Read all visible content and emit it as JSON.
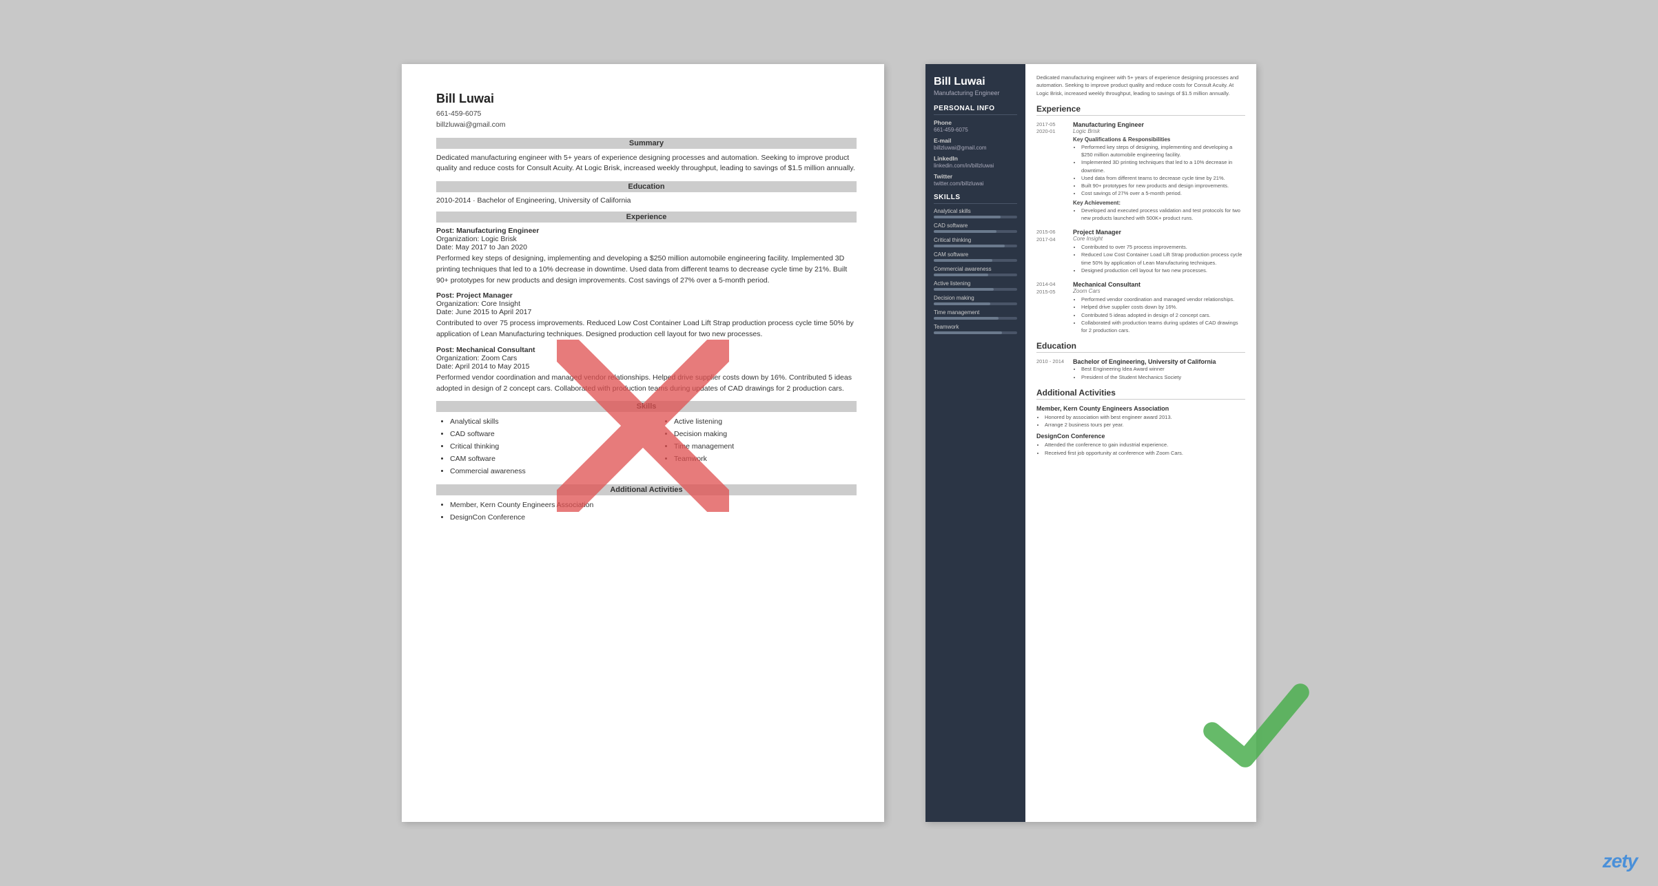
{
  "left_resume": {
    "name": "Bill Luwai",
    "phone": "661-459-6075",
    "email": "billzluwai@gmail.com",
    "summary_header": "Summary",
    "summary_text": "Dedicated manufacturing engineer with 5+ years of experience designing processes and automation. Seeking to improve product quality and reduce costs for Consult Acuity. At Logic Brisk, increased weekly throughput, leading to savings of $1.5 million annually.",
    "education_header": "Education",
    "education_entry": "2010-2014     ·  Bachelor of Engineering, University of California",
    "experience_header": "Experience",
    "exp1_post": "Post: Manufacturing Engineer",
    "exp1_org": "Organization: Logic Brisk",
    "exp1_date": "Date: May 2017 to Jan 2020",
    "exp1_body": "Performed key steps of designing, implementing and developing a $250 million automobile engineering facility. Implemented 3D printing techniques that led to a 10% decrease in downtime. Used data from different teams to decrease cycle time by 21%. Built 90+ prototypes for new products and design improvements. Cost savings of 27% over a 5-month period.",
    "exp2_post": "Post: Project Manager",
    "exp2_org": "Organization: Core Insight",
    "exp2_date": "Date: June 2015 to April 2017",
    "exp2_body": "Contributed to over 75 process improvements. Reduced Low Cost Container Load Lift Strap production process cycle time 50% by application of Lean Manufacturing techniques. Designed production cell layout for two new processes.",
    "exp3_post": "Post: Mechanical Consultant",
    "exp3_org": "Organization: Zoom Cars",
    "exp3_date": "Date: April 2014 to May 2015",
    "exp3_body": "Performed vendor coordination and managed vendor relationships. Helped drive supplier costs down by 16%. Contributed 5 ideas adopted in design of 2 concept cars. Collaborated with production teams during updates of CAD drawings for 2 production cars.",
    "skills_header": "Skills",
    "skills_col1": [
      "Analytical skills",
      "CAD software",
      "Critical thinking",
      "CAM software",
      "Commercial awareness"
    ],
    "skills_col2": [
      "Active listening",
      "Decision making",
      "Time management",
      "Teamwork"
    ],
    "additional_header": "Additional Activities",
    "additional_items": [
      "Member, Kern County Engineers Association",
      "DesignCon Conference"
    ]
  },
  "right_resume": {
    "name": "Bill Luwai",
    "title": "Manufacturing Engineer",
    "summary": "Dedicated manufacturing engineer with 5+ years of experience designing processes and automation. Seeking to improve product quality and reduce costs for Consult Acuity. At Logic Brisk, increased weekly throughput, leading to savings of $1.5 million annually.",
    "sidebar": {
      "personal_info_title": "Personal Info",
      "phone_label": "Phone",
      "phone_value": "661-459-6075",
      "email_label": "E-mail",
      "email_value": "billzluwai@gmail.com",
      "linkedin_label": "LinkedIn",
      "linkedin_value": "linkedin.com/in/billzluwai",
      "twitter_label": "Twitter",
      "twitter_value": "twitter.com/billzluwai",
      "skills_title": "Skills",
      "skills": [
        {
          "name": "Analytical skills",
          "pct": 80
        },
        {
          "name": "CAD software",
          "pct": 75
        },
        {
          "name": "Critical thinking",
          "pct": 85
        },
        {
          "name": "CAM software",
          "pct": 70
        },
        {
          "name": "Commercial awareness",
          "pct": 65
        },
        {
          "name": "Active listening",
          "pct": 72
        },
        {
          "name": "Decision making",
          "pct": 68
        },
        {
          "name": "Time management",
          "pct": 78
        },
        {
          "name": "Teamwork",
          "pct": 82
        }
      ]
    },
    "experience_title": "Experience",
    "experiences": [
      {
        "dates_start": "2017-05",
        "dates_end": "2020-01",
        "title": "Manufacturing Engineer",
        "company": "Logic Brisk",
        "qualifications_title": "Key Qualifications & Responsibilities",
        "qualifications": [
          "Performed key steps of designing, implementing and developing a $250 million automobile engineering facility.",
          "Implemented 3D printing techniques that led to a 10% decrease in downtime.",
          "Used data from different teams to decrease cycle time by 21%.",
          "Built 90+ prototypes for new products and design improvements.",
          "Cost savings of 27% over a 5-month period."
        ],
        "achievement_title": "Key Achievement:",
        "achievements": [
          "Developed and executed process validation and test protocols for two new products launched with 500K+ product runs."
        ]
      },
      {
        "dates_start": "2015-06",
        "dates_end": "2017-04",
        "title": "Project Manager",
        "company": "Core Insight",
        "qualifications": [
          "Contributed to over 75 process improvements.",
          "Reduced Low Cost Container Load Lift Strap production process cycle time 50% by application of Lean Manufacturing techniques.",
          "Designed production cell layout for two new processes."
        ]
      },
      {
        "dates_start": "2014-04",
        "dates_end": "2015-05",
        "title": "Mechanical Consultant",
        "company": "Zoom Cars",
        "qualifications": [
          "Performed vendor coordination and managed vendor relationships.",
          "Helped drive supplier costs down by 16%.",
          "Contributed 5 ideas adopted in design of 2 concept cars.",
          "Collaborated with production teams during updates of CAD drawings for 2 production cars."
        ]
      }
    ],
    "education_title": "Education",
    "education": [
      {
        "dates": "2010 - 2014",
        "degree": "Bachelor of Engineering, University of California",
        "items": [
          "Best Engineering Idea Award winner",
          "President of the Student Mechanics Society"
        ]
      }
    ],
    "additional_title": "Additional Activities",
    "additional": [
      {
        "title": "Member, Kern County Engineers Association",
        "items": [
          "Honored by association with best engineer award 2013.",
          "Arrange 2 business tours per year."
        ]
      },
      {
        "title": "DesignCon Conference",
        "items": [
          "Attended the conference to gain industrial experience.",
          "Received first job opportunity at conference with Zoom Cars."
        ]
      }
    ]
  },
  "zety_label": "zety"
}
